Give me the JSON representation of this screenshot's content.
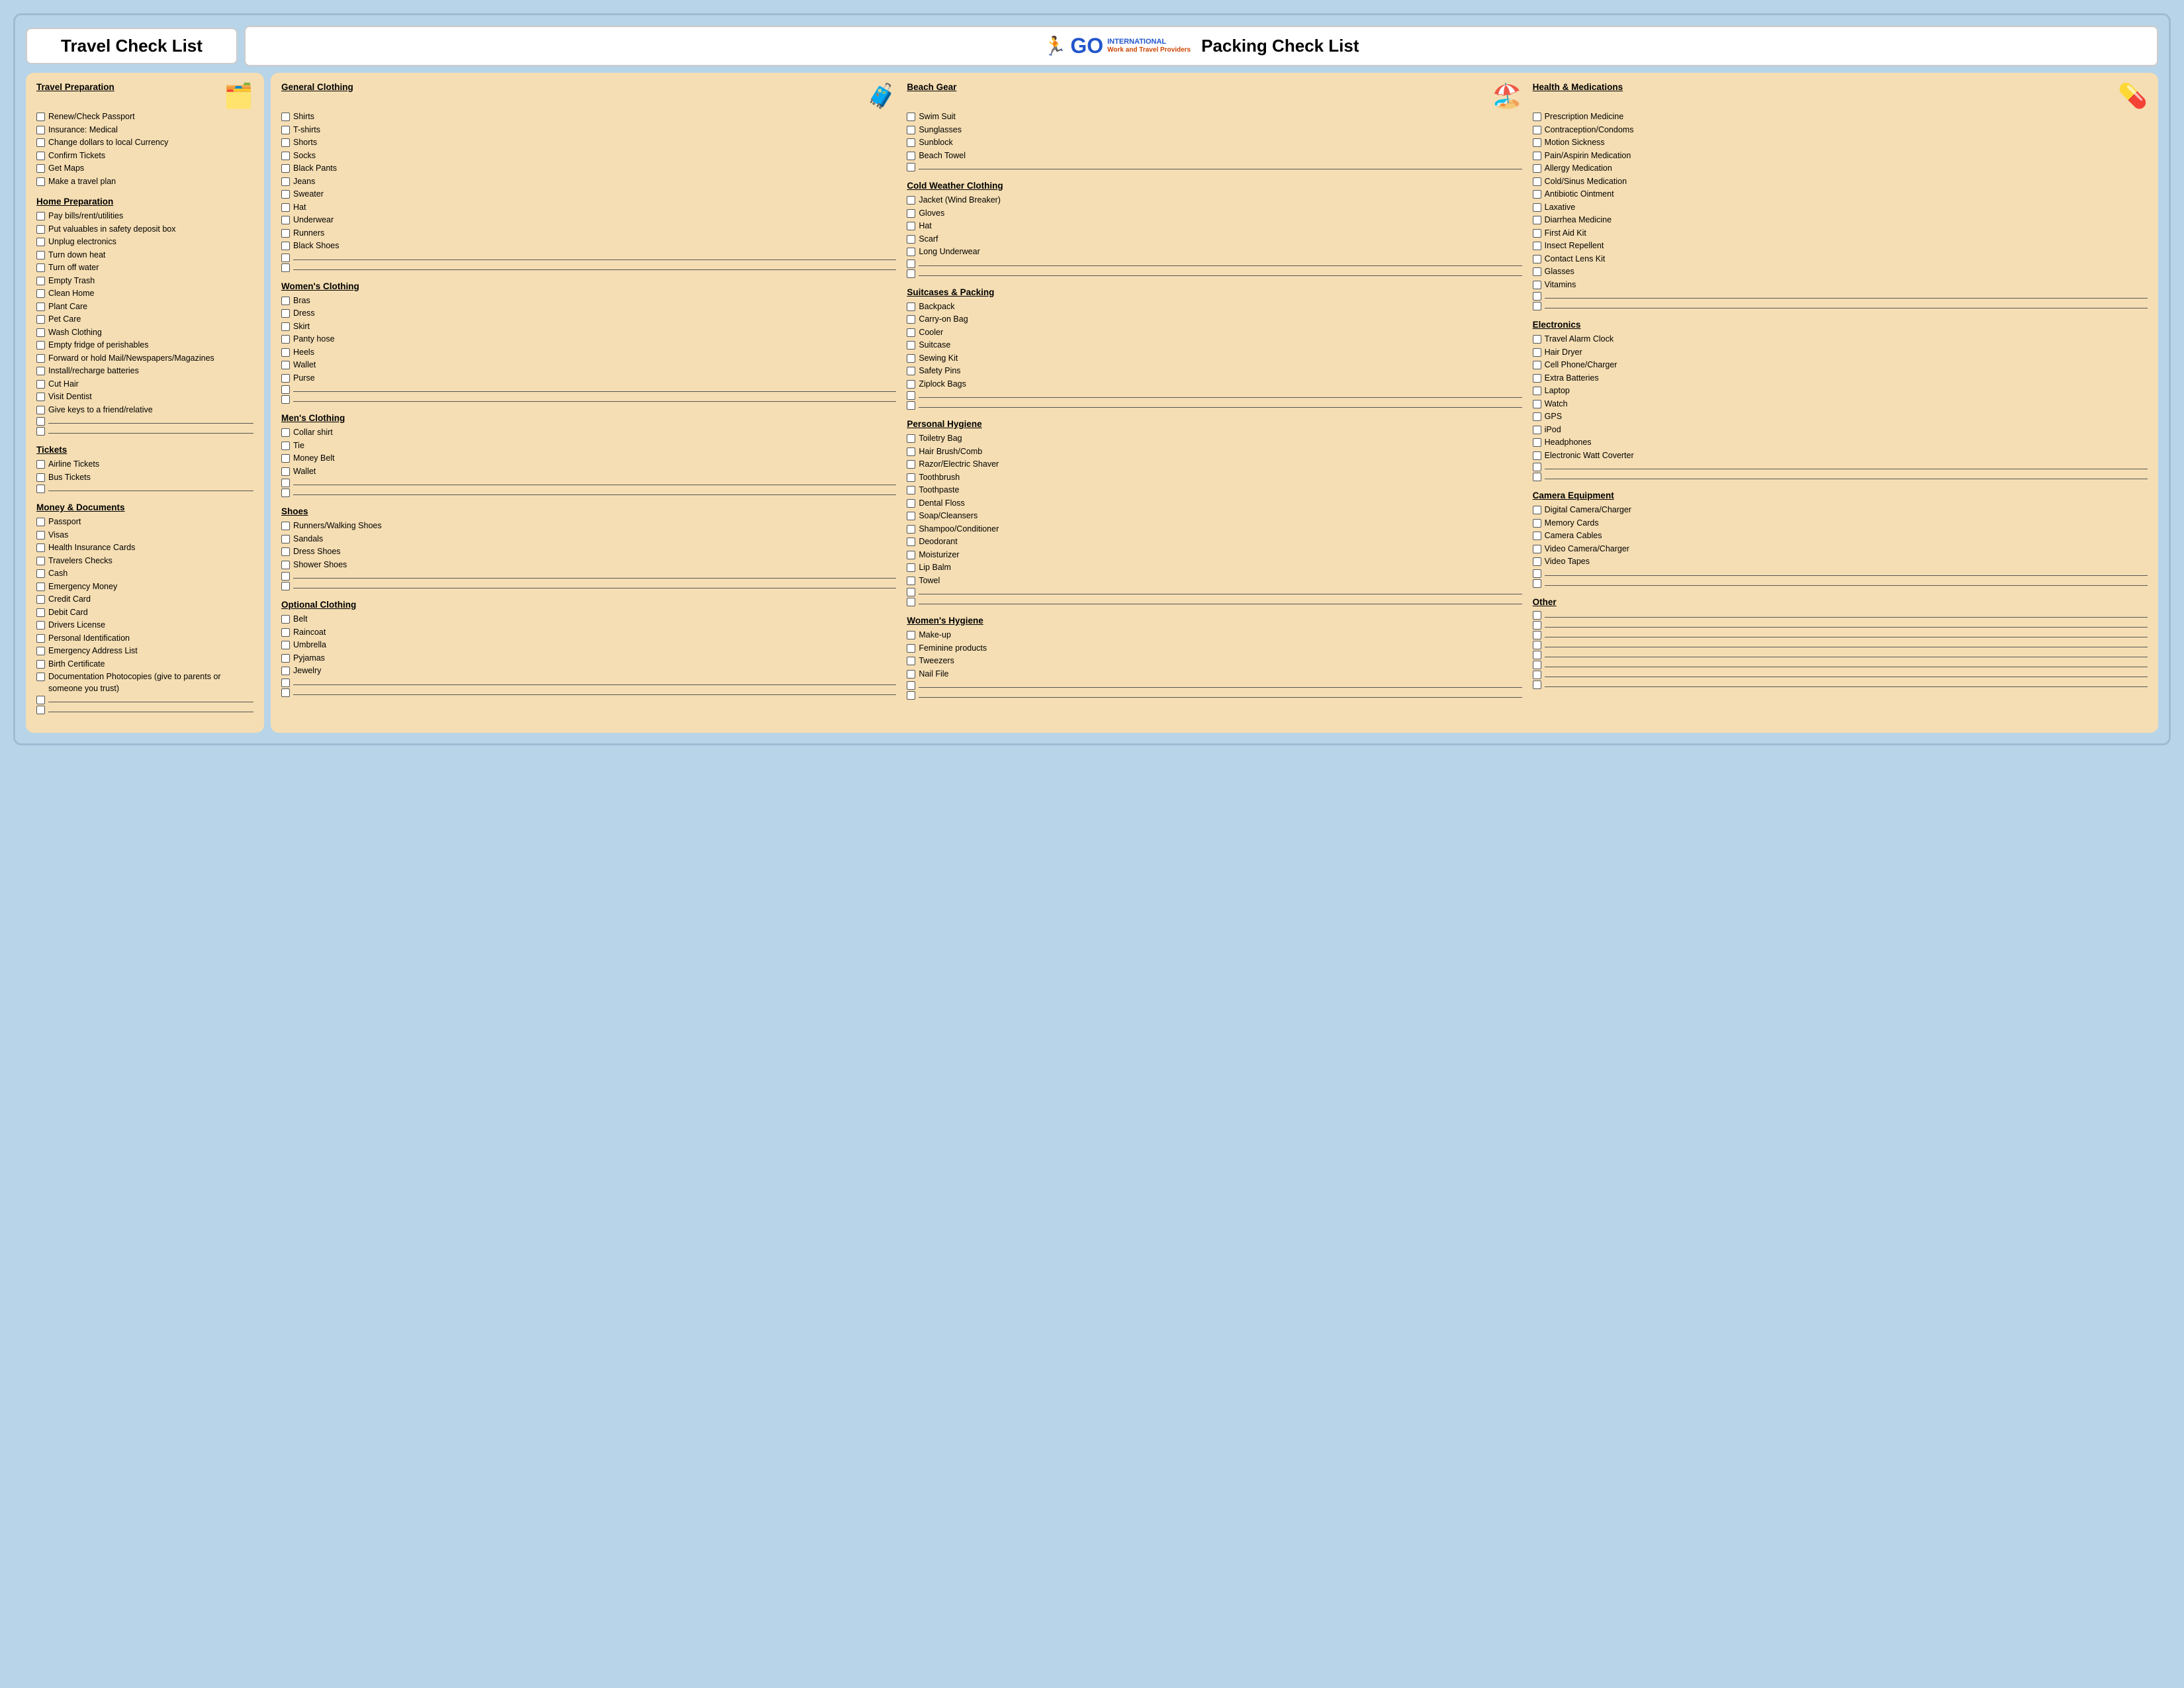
{
  "header": {
    "travel_title": "Travel Check List",
    "packing_title": "Packing Check List",
    "logo_go": "GO",
    "logo_international": "INTERNATIONAL",
    "logo_sub": "Work and Travel Providers"
  },
  "travel_sections": [
    {
      "id": "travel-preparation",
      "title": "Travel Preparation",
      "items": [
        "Renew/Check Passport",
        "Insurance: Medical",
        "Change dollars to local Currency",
        "Confirm Tickets",
        "Get Maps",
        "Make a travel plan"
      ],
      "blanks": 0
    },
    {
      "id": "home-preparation",
      "title": "Home Preparation",
      "items": [
        "Pay bills/rent/utilities",
        "Put valuables in safety deposit box",
        "Unplug electronics",
        "Turn down heat",
        "Turn off water",
        "Empty Trash",
        "Clean Home",
        "Plant Care",
        "Pet Care",
        "Wash Clothing",
        "Empty fridge of perishables",
        "Forward or hold Mail/Newspapers/Magazines",
        "Install/recharge batteries",
        "Cut Hair",
        "Visit Dentist",
        "Give keys to a friend/relative"
      ],
      "blanks": 2
    },
    {
      "id": "tickets",
      "title": "Tickets",
      "items": [
        "Airline Tickets",
        "Bus Tickets"
      ],
      "blanks": 1
    },
    {
      "id": "money-documents",
      "title": "Money & Documents",
      "items": [
        "Passport",
        "Visas",
        "Health Insurance Cards",
        "Travelers Checks",
        "Cash",
        "Emergency Money",
        "Credit Card",
        "Debit Card",
        "Drivers License",
        "Personal Identification",
        "Emergency Address List",
        "Birth Certificate",
        "Documentation Photocopies (give to parents or someone you trust)"
      ],
      "blanks": 2
    }
  ],
  "packing_col1": [
    {
      "id": "general-clothing",
      "title": "General Clothing",
      "items": [
        "Shirts",
        "T-shirts",
        "Shorts",
        "Socks",
        "Black Pants",
        "Jeans",
        "Sweater",
        "Hat",
        "Underwear",
        "Runners",
        "Black Shoes"
      ],
      "blanks": 2
    },
    {
      "id": "womens-clothing",
      "title": "Women's Clothing",
      "items": [
        "Bras",
        "Dress",
        "Skirt",
        "Panty hose",
        "Heels",
        "Wallet",
        "Purse"
      ],
      "blanks": 2
    },
    {
      "id": "mens-clothing",
      "title": "Men's Clothing",
      "items": [
        "Collar shirt",
        "Tie",
        "Money Belt",
        "Wallet"
      ],
      "blanks": 2
    },
    {
      "id": "shoes",
      "title": "Shoes",
      "items": [
        "Runners/Walking Shoes",
        "Sandals",
        "Dress Shoes",
        "Shower Shoes"
      ],
      "blanks": 2
    },
    {
      "id": "optional-clothing",
      "title": "Optional Clothing",
      "items": [
        "Belt",
        "Raincoat",
        "Umbrella",
        "Pyjamas",
        "Jewelry"
      ],
      "blanks": 2
    }
  ],
  "packing_col2": [
    {
      "id": "beach-gear",
      "title": "Beach Gear",
      "items": [
        "Swim Suit",
        "Sunglasses",
        "Sunblock",
        "Beach Towel"
      ],
      "blanks": 1
    },
    {
      "id": "cold-weather-clothing",
      "title": "Cold Weather Clothing",
      "items": [
        "Jacket (Wind Breaker)",
        "Gloves",
        "Hat",
        "Scarf",
        "Long Underwear"
      ],
      "blanks": 2
    },
    {
      "id": "suitcases-packing",
      "title": "Suitcases & Packing",
      "items": [
        "Backpack",
        "Carry-on Bag",
        "Cooler",
        "Suitcase",
        "Sewing Kit",
        "Safety Pins",
        "Ziplock Bags"
      ],
      "blanks": 2
    },
    {
      "id": "personal-hygiene",
      "title": "Personal Hygiene",
      "items": [
        "Toiletry Bag",
        "Hair Brush/Comb",
        "Razor/Electric Shaver",
        "Toothbrush",
        "Toothpaste",
        "Dental Floss",
        "Soap/Cleansers",
        "Shampoo/Conditioner",
        "Deodorant",
        "Moisturizer",
        "Lip Balm",
        "Towel"
      ],
      "blanks": 2
    },
    {
      "id": "womens-hygiene",
      "title": "Women's Hygiene",
      "items": [
        "Make-up",
        "Feminine products",
        "Tweezers",
        "Nail File"
      ],
      "blanks": 2
    }
  ],
  "packing_col3": [
    {
      "id": "health-medications",
      "title": "Health & Medications",
      "items": [
        "Prescription Medicine",
        "Contraception/Condoms",
        "Motion Sickness",
        "Pain/Aspirin Medication",
        "Allergy Medication",
        "Cold/Sinus Medication",
        "Antibiotic Ointment",
        "Laxative",
        "Diarrhea Medicine",
        "First Aid Kit",
        "Insect Repellent",
        "Contact Lens Kit",
        "Glasses",
        "Vitamins"
      ],
      "blanks": 2
    },
    {
      "id": "electronics",
      "title": "Electronics",
      "items": [
        "Travel Alarm Clock",
        "Hair Dryer",
        "Cell Phone/Charger",
        "Extra Batteries",
        "Laptop",
        "Watch",
        "GPS",
        "iPod",
        "Headphones",
        "Electronic Watt Coverter"
      ],
      "blanks": 2
    },
    {
      "id": "camera-equipment",
      "title": "Camera Equipment",
      "items": [
        "Digital Camera/Charger",
        "Memory Cards",
        "Camera Cables",
        "Video Camera/Charger",
        "Video Tapes"
      ],
      "blanks": 2
    },
    {
      "id": "other",
      "title": "Other",
      "items": [],
      "blanks": 8
    }
  ]
}
